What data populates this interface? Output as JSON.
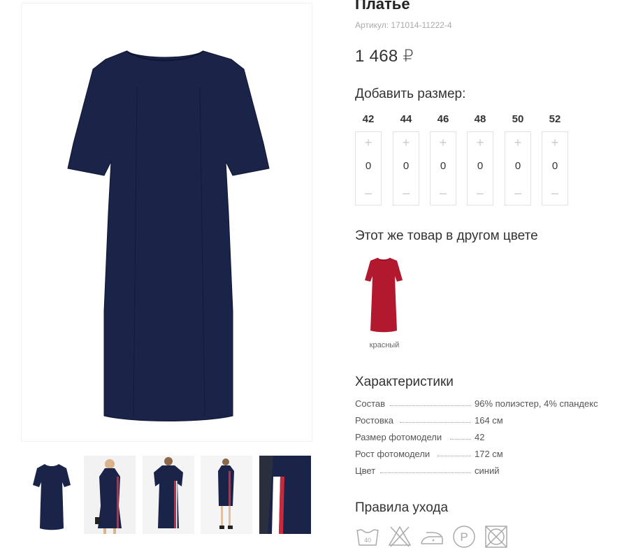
{
  "product": {
    "title": "Платье",
    "sku": "Артикул: 171014-11222-4",
    "price": "1 468 ₽"
  },
  "sizes": {
    "heading": "Добавить размер:",
    "items": [
      {
        "label": "42",
        "qty": "0"
      },
      {
        "label": "44",
        "qty": "0"
      },
      {
        "label": "46",
        "qty": "0"
      },
      {
        "label": "48",
        "qty": "0"
      },
      {
        "label": "50",
        "qty": "0"
      },
      {
        "label": "52",
        "qty": "0"
      }
    ],
    "plus": "+",
    "minus": "–"
  },
  "colors": {
    "heading": "Этот же товар в другом цвете",
    "items": [
      {
        "name": "красный",
        "hex": "#b3192e"
      }
    ]
  },
  "specs": {
    "heading": "Характеристики",
    "rows": [
      {
        "key": "Состав",
        "value": "96% полиэстер, 4% спандекс"
      },
      {
        "key": "Ростовка",
        "value": "164 см"
      },
      {
        "key": "Размер фотомодели",
        "value": "42"
      },
      {
        "key": "Рост фотомодели",
        "value": "172 см"
      },
      {
        "key": "Цвет",
        "value": "синий"
      }
    ]
  },
  "care": {
    "heading": "Правила ухода",
    "icons": [
      "wash-40-icon",
      "no-bleach-icon",
      "iron-low-icon",
      "dry-clean-p-icon",
      "no-tumble-dry-icon"
    ],
    "wash_temp": "40"
  },
  "gallery": {
    "thumbnails": [
      "dress-front",
      "model-front-bag",
      "model-back-side",
      "model-full-side",
      "fabric-detail"
    ],
    "active_index": 0
  },
  "colors_palette": {
    "dress": "#1a2449",
    "accent": "#3cc4b3"
  }
}
